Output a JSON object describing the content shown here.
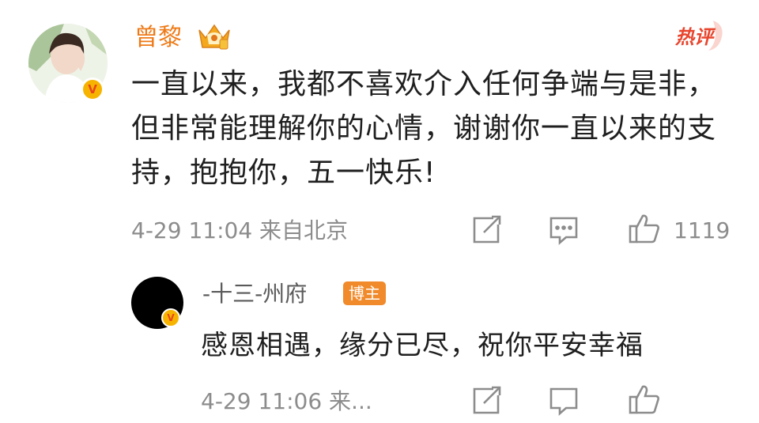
{
  "main_comment": {
    "author": "曾黎",
    "hot_badge": "热评",
    "text": "一直以来，我都不喜欢介入任何争端与是非，但非常能理解你的心情，谢谢你一直以来的支持，抱抱你，五一快乐!",
    "meta": "4-29 11:04  来自北京",
    "like_count": "1119",
    "icons": [
      "share-icon",
      "comment-icon",
      "like-icon",
      "verified-icon",
      "crown-badge-icon"
    ]
  },
  "reply": {
    "author": "-十三-州府",
    "author_badge": "博主",
    "text": "感恩相遇，缘分已尽，祝你平安幸福",
    "meta": "4-29 11:06  来...",
    "icons": [
      "share-icon",
      "comment-icon",
      "like-icon",
      "verified-icon"
    ]
  },
  "colors": {
    "author_orange": "#ee7a17",
    "hot_red": "#e8452e",
    "meta_gray": "#8c8c8c",
    "verify_gold": "#f6b400",
    "host_badge": "#f08a2b"
  }
}
